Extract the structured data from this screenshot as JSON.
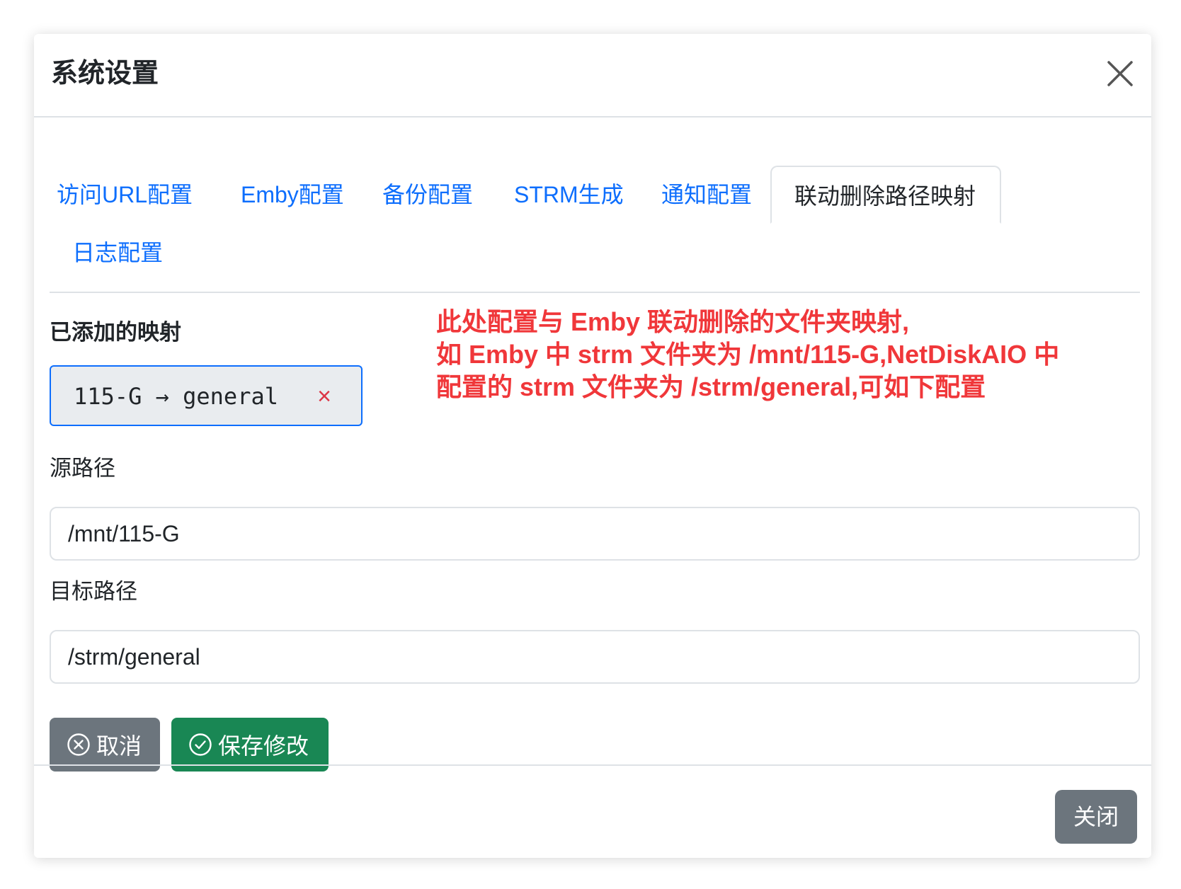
{
  "modal": {
    "title": "系统设置"
  },
  "tabs": [
    {
      "label": "访问URL配置"
    },
    {
      "label": "Emby配置"
    },
    {
      "label": "备份配置"
    },
    {
      "label": "STRM生成"
    },
    {
      "label": "通知配置"
    },
    {
      "label": "联动删除路径映射",
      "active": true
    },
    {
      "label": "日志配置"
    }
  ],
  "mappings": {
    "label": "已添加的映射",
    "items": [
      {
        "text": "115-G → general",
        "remove": "×"
      }
    ]
  },
  "note": {
    "lines": [
      "此处配置与 Emby 联动删除的文件夹映射,",
      "如 Emby 中 strm 文件夹为 /mnt/115-G,NetDiskAIO 中",
      "配置的 strm 文件夹为 /strm/general,可如下配置"
    ],
    "color": "#f0373a"
  },
  "form": {
    "source_label": "源路径",
    "source_value": "/mnt/115-G",
    "target_label": "目标路径",
    "target_value": "/strm/general"
  },
  "actions": {
    "cancel_label": "取消",
    "save_label": "保存修改"
  },
  "footer": {
    "close_label": "关闭"
  },
  "colors": {
    "primary": "#0d6efd",
    "secondary": "#6c757d",
    "success": "#198754",
    "danger": "#dc3545"
  }
}
